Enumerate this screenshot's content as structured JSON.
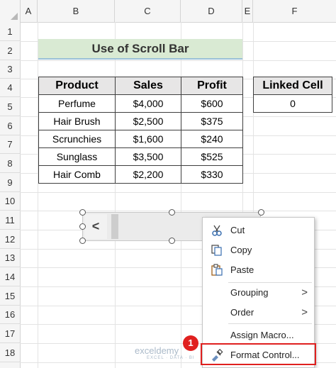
{
  "columns": [
    "A",
    "B",
    "C",
    "D",
    "E",
    "F"
  ],
  "rows": [
    "1",
    "2",
    "3",
    "4",
    "5",
    "6",
    "7",
    "8",
    "9",
    "10",
    "11",
    "12",
    "13",
    "14",
    "15",
    "16",
    "17",
    "18"
  ],
  "title": "Use of Scroll Bar",
  "table": {
    "headers": [
      "Product",
      "Sales",
      "Profit"
    ],
    "rows": [
      [
        "Perfume",
        "$4,000",
        "$600"
      ],
      [
        "Hair Brush",
        "$2,500",
        "$375"
      ],
      [
        "Scrunchies",
        "$1,600",
        "$240"
      ],
      [
        "Sunglass",
        "$3,500",
        "$525"
      ],
      [
        "Hair Comb",
        "$2,200",
        "$330"
      ]
    ]
  },
  "linked": {
    "header": "Linked Cell",
    "value": "0"
  },
  "scrollbar": {
    "left_arrow": "<"
  },
  "menu": {
    "cut": "Cut",
    "copy": "Copy",
    "paste": "Paste",
    "grouping": "Grouping",
    "order": "Order",
    "assign_macro": "Assign Macro...",
    "format_control": "Format Control...",
    "arrow": ">"
  },
  "badge": "1",
  "watermark": {
    "name": "exceldemy",
    "tagline": "EXCEL · DATA · BI"
  },
  "colors": {
    "accent": "#e0201f",
    "title_bg": "#d9ead3",
    "header_bg": "#e7e6e6"
  }
}
